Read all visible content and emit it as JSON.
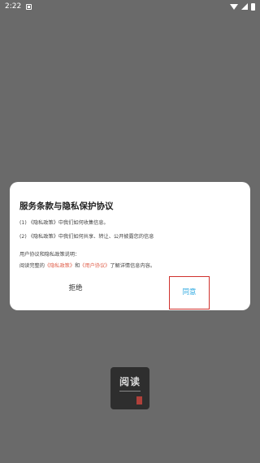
{
  "status_bar": {
    "time": "2:22",
    "icons": [
      "notification-icon",
      "wifi-icon",
      "signal-icon",
      "battery-icon"
    ]
  },
  "dialog": {
    "title": "服务条款与隐私保护协议",
    "item1": "(1) 《隐私政策》中我们如何收集信息。",
    "item2": "(2) 《隐私政策》中我们如何共享、转让、公开披露您的信息",
    "note": "用户协议和隐私政策说明：",
    "read_prefix": "阅读完整的",
    "privacy_link": "《隐私政策》",
    "and_text": "和",
    "user_link": "《用户协议》",
    "read_suffix": "了解详情信息内容。",
    "reject_label": "拒绝",
    "agree_label": "同意"
  },
  "app_logo": {
    "text": "阅读"
  },
  "colors": {
    "overlay": "#6a6a6a",
    "link": "#e0604c",
    "accent": "#2aa7e0",
    "highlight_border": "#d0312d"
  }
}
